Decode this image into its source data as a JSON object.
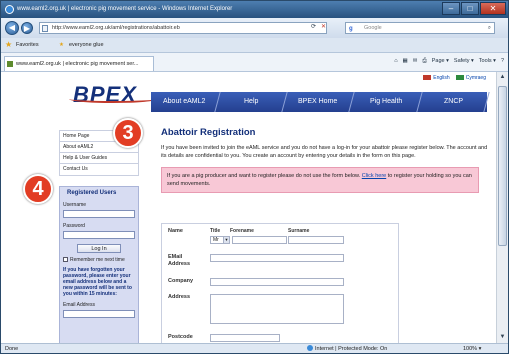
{
  "window": {
    "title": "www.eaml2.org.uk | electronic pig movement service - Windows Internet Explorer",
    "buttons": {
      "minimize": "–",
      "maximize": "□",
      "close": "✕"
    }
  },
  "addressbar": {
    "url": "http://www.eaml2.org.uk/aml/registrations/abattoir.eb",
    "search_placeholder": "Google"
  },
  "favorites": {
    "label": "Favorites",
    "item": "everyone glue"
  },
  "tab": {
    "title": "www.eaml2.org.uk | electronic pig movement ser..."
  },
  "commandbar": {
    "page": "Page ▾",
    "safety": "Safety ▾",
    "tools": "Tools ▾"
  },
  "page": {
    "toplinks": {
      "english": "English",
      "cymraeg": "Cymraeg"
    },
    "logo": "BPEX",
    "nav": [
      "About eAML2",
      "Help",
      "BPEX Home",
      "Pig Health",
      "ZNCP"
    ],
    "sidemenu": [
      "Home Page",
      "About eAML2",
      "Help & User Guides",
      "Contact Us"
    ],
    "login": {
      "heading": "Registered Users",
      "username_label": "Username",
      "password_label": "Password",
      "login_button": "Log In",
      "remember_label": "Remember me next time",
      "forgot_text": "If you have forgotten your password, please enter your email address below and a new password will be sent to you within 15 minutes:",
      "email_label": "Email Address"
    },
    "main": {
      "title": "Abattoir Registration",
      "intro": "If you have been invited to join the eAML service and you do not have a log-in for your abattoir please register below. The account and its details are confidential to you. You create an account by entering your details in the form on this page.",
      "notice_before": "If you are a pig producer and want to register please do not use the form below.",
      "notice_link": "Click here",
      "notice_after": "to register your holding so you can send movements."
    },
    "form": {
      "name_label": "Name",
      "title_head": "Title",
      "forename_head": "Forename",
      "surname_head": "Surname",
      "title_value": "Mr",
      "email_label": "EMail Address",
      "company_label": "Company",
      "address_label": "Address",
      "postcode_label": "Postcode"
    }
  },
  "status": {
    "left": "Done",
    "zone": "Internet | Protected Mode: On",
    "zoom": "100% ▾"
  },
  "annotations": {
    "step3": "3",
    "step4": "4"
  },
  "colors": {
    "brand_navy": "#14307a",
    "nav_blue": "#2f4fa6",
    "notice_pink": "#f8c8d6",
    "marker_red": "#e23d24"
  }
}
